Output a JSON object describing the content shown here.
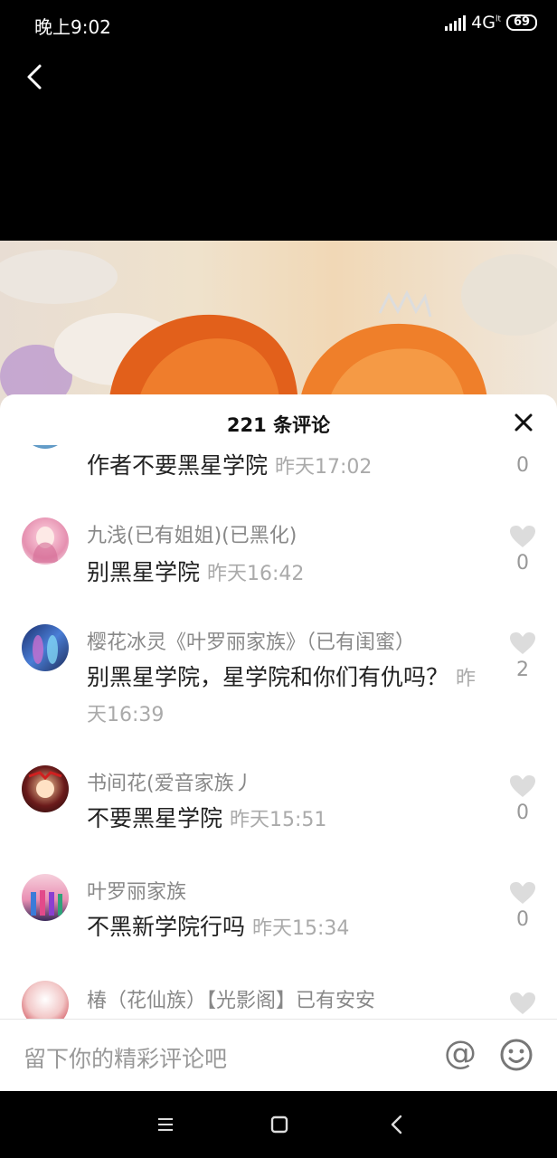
{
  "status_bar": {
    "time": "晚上9:02",
    "network": "4G",
    "battery": "69"
  },
  "header": {
    "comment_count": "221 条评论"
  },
  "comments": [
    {
      "username": "",
      "text": "作者不要黑星学院",
      "time": "昨天17:02",
      "likes": "0"
    },
    {
      "username": "九浅(已有姐姐)(已黑化)",
      "text": "别黑星学院",
      "time": "昨天16:42",
      "likes": "0"
    },
    {
      "username": "樱花冰灵《叶罗丽家族》（已有闺蜜）",
      "text": "别黑星学院，星学院和你们有仇吗？",
      "time": "昨天16:39",
      "likes": "2"
    },
    {
      "username": "书间花(爱音家族丿",
      "text": "不要黑星学院",
      "time": "昨天15:51",
      "likes": "0"
    },
    {
      "username": "叶罗丽家族",
      "text": "不黑新学院行吗",
      "time": "昨天15:34",
      "likes": "0"
    },
    {
      "username": "椿（花仙族）【光影阁】已有安安",
      "text": "",
      "time": "",
      "likes": ""
    }
  ],
  "input": {
    "placeholder": "留下你的精彩评论吧",
    "at_symbol": "@"
  },
  "icons": {
    "back": "chevron-left-icon",
    "close": "close-icon",
    "like": "heart-icon",
    "emoji": "smiley-icon",
    "nav_menu": "menu-icon",
    "nav_home": "square-icon",
    "nav_back": "triangle-back-icon"
  },
  "colors": {
    "username": "#888888",
    "time": "#aaaaaa",
    "heart": "#dcdcdc"
  }
}
